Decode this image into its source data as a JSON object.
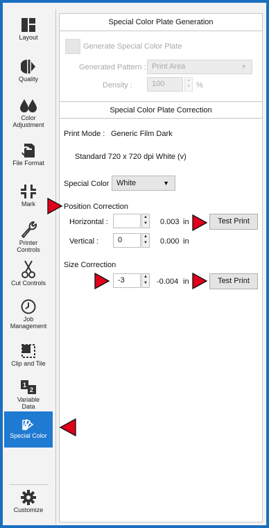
{
  "sidebar": {
    "items": [
      {
        "label": "Layout",
        "icon": "layout-icon"
      },
      {
        "label": "Quality",
        "icon": "quality-icon"
      },
      {
        "label": "Color Adjustment",
        "icon": "color-adjustment-icon"
      },
      {
        "label": "File Format",
        "icon": "file-format-icon"
      },
      {
        "label": "Mark",
        "icon": "mark-icon"
      },
      {
        "label": "Printer Controls",
        "icon": "wrench-icon"
      },
      {
        "label": "Cut Controls",
        "icon": "scissors-icon"
      },
      {
        "label": "Job Management",
        "icon": "clock-icon"
      },
      {
        "label": "Clip and Tile",
        "icon": "clip-tile-icon"
      },
      {
        "label": "Variable Data",
        "icon": "variable-data-icon"
      },
      {
        "label": "Special Color",
        "icon": "special-color-icon"
      }
    ],
    "customize": {
      "label": "Customize",
      "icon": "gear-icon"
    }
  },
  "generation": {
    "title": "Special Color Plate Generation",
    "checkbox_label": "Generate Special Color Plate",
    "pattern_label": "Generated Pattern :",
    "pattern_value": "Print Area",
    "density_label": "Density :",
    "density_value": "100",
    "density_unit": "%"
  },
  "correction": {
    "title": "Special Color Plate Correction",
    "print_mode_label": "Print Mode :",
    "print_mode_value": "Generic Film Dark",
    "resolution": "Standard 720 x 720 dpi White (v)",
    "special_color_label": "Special Color",
    "special_color_value": "White",
    "position_title": "Position Correction",
    "horizontal_label": "Horizontal :",
    "horizontal_value": "",
    "horizontal_measure": "0.003",
    "horizontal_unit": "in",
    "vertical_label": "Vertical :",
    "vertical_value": "0",
    "vertical_measure": "0.000",
    "vertical_unit": "in",
    "size_title": "Size Correction",
    "size_value": "-3",
    "size_measure": "-0.004",
    "size_unit": "in",
    "test_print_label": "Test Print"
  },
  "colors": {
    "accent": "#1f7ad1",
    "border": "#1c6fc0",
    "marker": "#e0001b"
  }
}
